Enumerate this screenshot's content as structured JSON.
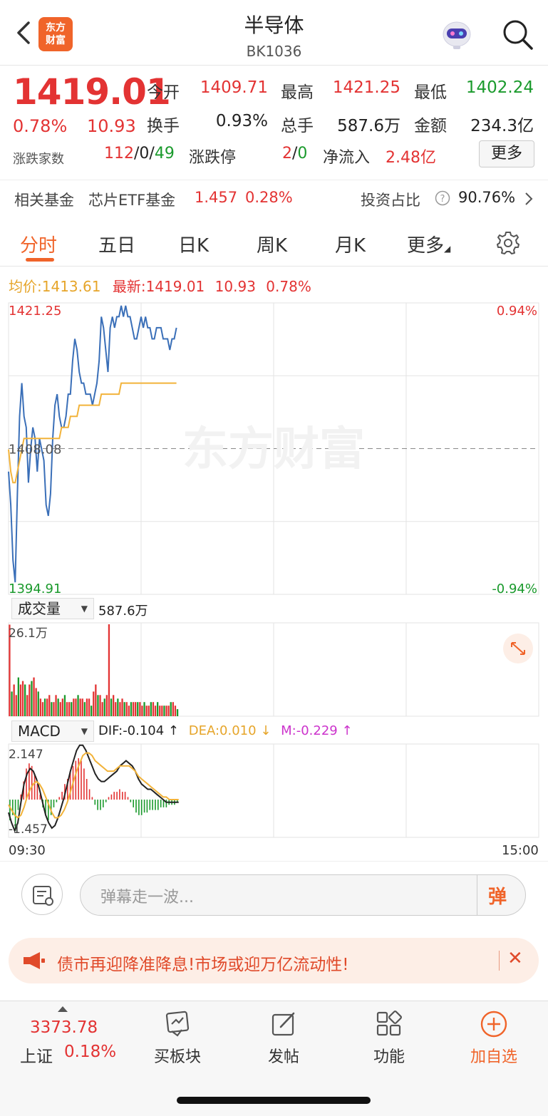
{
  "header": {
    "title": "半导体",
    "code": "BK1036",
    "logo_text": "东方财富"
  },
  "quote": {
    "price": "1419.01",
    "pct": "0.78%",
    "change": "10.93",
    "open_label": "今开",
    "open": "1409.71",
    "high_label": "最高",
    "high": "1421.25",
    "low_label": "最低",
    "low": "1402.24",
    "turnover_label": "换手",
    "turnover": "0.93%",
    "volume_label": "总手",
    "volume": "587.6万",
    "amount_label": "金额",
    "amount": "234.3亿",
    "breadth_label": "涨跌家数",
    "breadth_up": "112",
    "breadth_flat": "0",
    "breadth_down": "49",
    "limit_label": "涨跌停",
    "limit_up": "2",
    "limit_down": "0",
    "inflow_label": "净流入",
    "inflow": "2.48亿",
    "more_label": "更多"
  },
  "fund": {
    "label": "相关基金",
    "name": "芯片ETF基金",
    "price": "1.457",
    "pct": "0.28%",
    "ratio_label": "投资占比",
    "ratio": "90.76%"
  },
  "tabs": [
    "分时",
    "五日",
    "日K",
    "周K",
    "月K",
    "更多"
  ],
  "avgrow": {
    "avg_label": "均价:",
    "avg": "1413.61",
    "last_label": "最新:",
    "last": "1419.01",
    "chg": "10.93",
    "pct": "0.78%"
  },
  "chart_data": [
    {
      "type": "line",
      "title": "",
      "x_range": [
        "09:30",
        "15:00"
      ],
      "y_max": "1421.25",
      "y_max_pct": "0.94%",
      "y_min": "1394.91",
      "y_min_pct": "-0.94%",
      "y_ref": "1408.08",
      "watermark": "东方财富",
      "series": [
        {
          "name": "最新",
          "color": "#3a6fb8",
          "values": [
            1406,
            1403,
            1398,
            1396,
            1404,
            1411,
            1414,
            1411,
            1410,
            1405,
            1408,
            1410,
            1409,
            1406,
            1409,
            1408,
            1407,
            1403,
            1402,
            1404,
            1409,
            1412,
            1413,
            1411,
            1410,
            1410,
            1411,
            1413,
            1413,
            1416,
            1418,
            1417,
            1415,
            1414,
            1414,
            1413,
            1413,
            1413,
            1412,
            1413,
            1414,
            1416,
            1420,
            1419,
            1417,
            1415,
            1419,
            1420,
            1419,
            1420,
            1420,
            1421,
            1420,
            1421,
            1420,
            1420,
            1419,
            1418,
            1418,
            1419,
            1420,
            1419,
            1420,
            1419,
            1419,
            1418,
            1418,
            1419,
            1419,
            1419,
            1418,
            1418,
            1418,
            1417,
            1418,
            1418,
            1419
          ]
        },
        {
          "name": "均价",
          "color": "#f2b33a",
          "values": [
            1408,
            1406,
            1405,
            1405,
            1406,
            1407,
            1408,
            1409,
            1409,
            1409,
            1409,
            1409,
            1409,
            1409,
            1409,
            1409,
            1409,
            1409,
            1409,
            1409,
            1409,
            1409,
            1409,
            1409,
            1410,
            1410,
            1410,
            1410,
            1411,
            1411,
            1411,
            1411,
            1412,
            1412,
            1412,
            1412,
            1412,
            1412,
            1412,
            1412,
            1412,
            1412,
            1413,
            1413,
            1413,
            1413,
            1413,
            1413,
            1413,
            1413,
            1413,
            1414,
            1414,
            1414,
            1414,
            1414,
            1414,
            1414,
            1414,
            1414,
            1414,
            1414,
            1414,
            1414,
            1414,
            1414,
            1414,
            1414,
            1414,
            1414,
            1414,
            1414,
            1414,
            1414,
            1414,
            1414,
            1414
          ]
        }
      ]
    },
    {
      "type": "bar",
      "title": "成交量",
      "total": "587.6万",
      "y_max": "26.1万",
      "values": [
        26,
        7,
        9,
        6,
        11,
        9,
        10,
        9,
        6,
        9,
        10,
        11,
        8,
        7,
        5,
        4,
        5,
        5,
        6,
        4,
        4,
        6,
        5,
        4,
        5,
        6,
        4,
        4,
        4,
        5,
        5,
        6,
        5,
        5,
        4,
        5,
        5,
        3,
        7,
        9,
        6,
        6,
        4,
        5,
        6,
        4,
        5,
        6,
        4,
        5,
        4,
        5,
        4,
        4,
        3,
        4,
        4,
        4,
        4,
        4,
        3,
        4,
        3,
        3,
        4,
        4,
        3,
        4,
        3,
        3,
        3,
        3,
        3,
        4,
        4,
        3,
        2
      ],
      "spike": {
        "index": 45,
        "value": 26.1
      }
    },
    {
      "type": "bar",
      "title": "MACD",
      "dif": "DIF:-0.104 ↑",
      "dea": "DEA:0.010 ↓",
      "m": "M:-0.229 ↑",
      "y_max": "2.147",
      "y_min": "-1.457",
      "hist": [
        -0.8,
        -0.6,
        -1.2,
        -0.4,
        0.2,
        0.7,
        1.2,
        1.4,
        1.3,
        1.0,
        0.6,
        0.2,
        -0.3,
        -0.6,
        -0.8,
        -0.6,
        -0.3,
        -0.1,
        0.1,
        0.3,
        0.6,
        0.8,
        1.1,
        1.3,
        1.5,
        1.6,
        1.5,
        1.2,
        0.8,
        0.4,
        0.1,
        -0.2,
        -0.4,
        -0.4,
        -0.3,
        -0.1,
        0.1,
        0.2,
        0.3,
        0.3,
        0.4,
        0.3,
        0.3,
        0.1,
        -0.1,
        -0.3,
        -0.5,
        -0.6,
        -0.6,
        -0.5,
        -0.5,
        -0.4,
        -0.4,
        -0.4,
        -0.4,
        -0.3,
        -0.3,
        -0.3,
        -0.2,
        -0.2,
        -0.2,
        -0.1
      ],
      "dif_line": [
        -0.5,
        -0.9,
        -1.2,
        -0.9,
        -0.1,
        0.6,
        1.0,
        1.2,
        1.1,
        0.8,
        0.4,
        -0.1,
        -0.6,
        -0.9,
        -1.1,
        -1.0,
        -0.7,
        -0.3,
        0.1,
        0.6,
        1.1,
        1.5,
        1.9,
        2.1,
        2.1,
        1.9,
        1.6,
        1.3,
        1.0,
        0.8,
        0.7,
        0.7,
        0.8,
        0.9,
        1.0,
        1.1,
        1.3,
        1.4,
        1.5,
        1.4,
        1.3,
        1.1,
        0.8,
        0.6,
        0.5,
        0.4,
        0.4,
        0.3,
        0.2,
        0.1,
        0.0,
        -0.1,
        -0.1,
        -0.1,
        -0.1,
        -0.1
      ],
      "dea_line": [
        -0.2,
        -0.4,
        -0.6,
        -0.7,
        -0.6,
        -0.3,
        0.1,
        0.4,
        0.6,
        0.7,
        0.6,
        0.4,
        0.1,
        -0.2,
        -0.5,
        -0.7,
        -0.7,
        -0.6,
        -0.4,
        -0.1,
        0.3,
        0.7,
        1.1,
        1.4,
        1.7,
        1.8,
        1.8,
        1.7,
        1.5,
        1.4,
        1.3,
        1.2,
        1.1,
        1.1,
        1.1,
        1.2,
        1.3,
        1.3,
        1.3,
        1.3,
        1.2,
        1.1,
        0.9,
        0.8,
        0.7,
        0.6,
        0.5,
        0.4,
        0.3,
        0.2,
        0.1,
        0.1,
        0.0,
        0.0,
        0.0,
        0.0
      ]
    }
  ],
  "comment": {
    "placeholder": "弹幕走一波...",
    "dan": "弹"
  },
  "banner": {
    "text": "债市再迎降准降息!市场或迎万亿流动性!"
  },
  "footer": {
    "index_value": "3373.78",
    "index_name": "上证",
    "index_pct": "0.18%",
    "buttons": [
      "买板块",
      "发帖",
      "功能",
      "加自选"
    ]
  },
  "colors": {
    "accent": "#f0642a",
    "up": "#e33333",
    "down": "#1a9a2c",
    "price_line": "#3a6fb8",
    "avg_line": "#f2b33a"
  }
}
